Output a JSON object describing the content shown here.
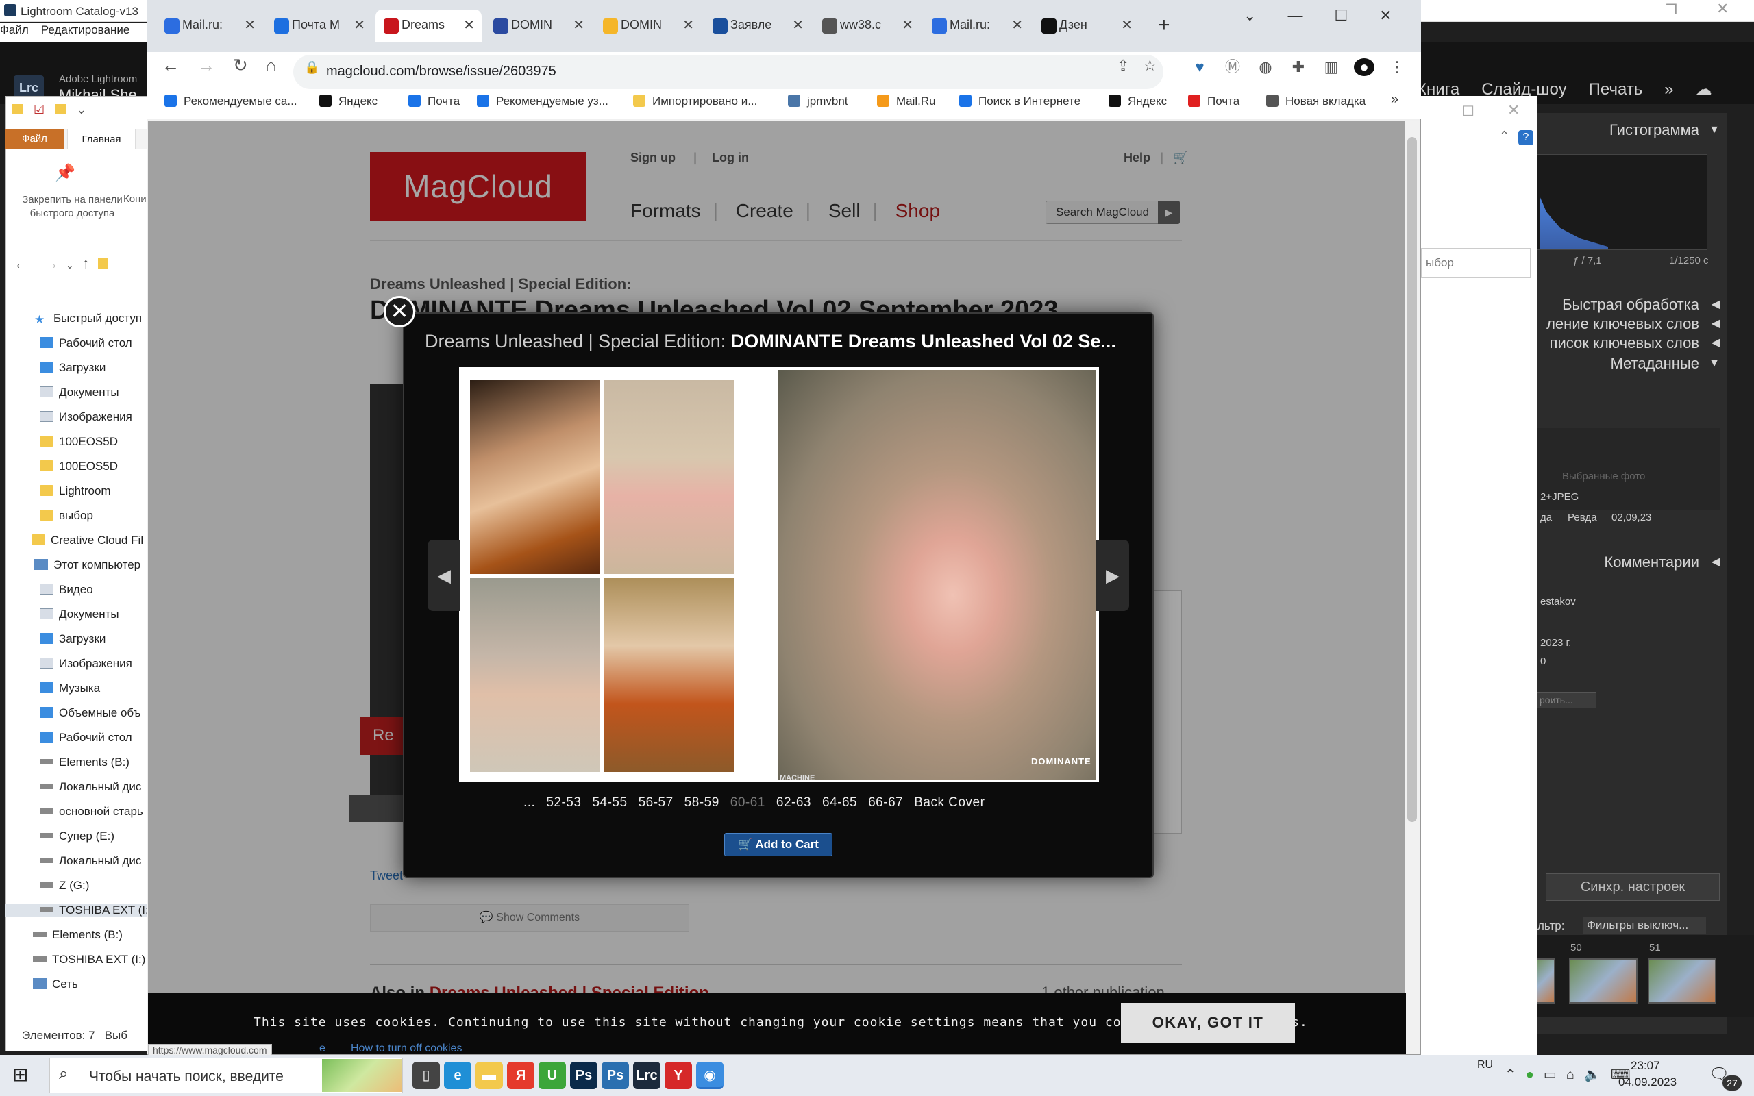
{
  "lightroom": {
    "window_title": "Lightroom Catalog-v13",
    "menu": [
      "Файл",
      "Редактирование"
    ],
    "brand": "Adobe Lightroom",
    "user": "Mikhail She",
    "modules": [
      "Книга",
      "Слайд-шоу",
      "Печать"
    ],
    "panels": [
      "Гистограмма",
      "Быстрая обработка",
      "ление ключевых слов",
      "писок ключевых слов",
      "Метаданные",
      "Комментарии"
    ],
    "histo_aperture": "ƒ / 7,1",
    "histo_shutter": "1/1250 с",
    "meta_saved": "Выбранные фото",
    "meta_format": "2+JPEG",
    "meta_row_1": "да",
    "meta_row_2": "Ревда",
    "meta_row_3": "02,09,23",
    "meta_author": "estakov",
    "meta_date": "2023 г.",
    "meta_d2": "0",
    "meta_btn": "роить...",
    "sync_btn": "Синхр. настроек",
    "filter_label": "льтр:",
    "filter_value": "Фильтры выключ...",
    "film_nums": [
      "50",
      "51"
    ]
  },
  "lr_dialog": {
    "search": "ыбор",
    "help": "?"
  },
  "explorer": {
    "tab_file": "Файл",
    "tab_home": "Главная",
    "pin_label": "Закрепить на панели быстрого доступа",
    "copy_label": "Копи",
    "tree": [
      {
        "label": "Быстрый доступ",
        "icon": "star"
      },
      {
        "label": "Рабочий стол",
        "icon": "blue"
      },
      {
        "label": "Загрузки",
        "icon": "blue"
      },
      {
        "label": "Документы",
        "icon": "doc"
      },
      {
        "label": "Изображения",
        "icon": "doc"
      },
      {
        "label": "100EOS5D",
        "icon": "folder"
      },
      {
        "label": "100EOS5D",
        "icon": "folder"
      },
      {
        "label": "Lightroom",
        "icon": "folder"
      },
      {
        "label": "выбор",
        "icon": "folder"
      },
      {
        "label": "Creative Cloud Fil",
        "icon": "folder"
      },
      {
        "label": "Этот компьютер",
        "icon": "pc"
      },
      {
        "label": "Видео",
        "icon": "doc"
      },
      {
        "label": "Документы",
        "icon": "doc"
      },
      {
        "label": "Загрузки",
        "icon": "blue"
      },
      {
        "label": "Изображения",
        "icon": "doc"
      },
      {
        "label": "Музыка",
        "icon": "blue"
      },
      {
        "label": "Объемные объ",
        "icon": "blue"
      },
      {
        "label": "Рабочий стол",
        "icon": "blue"
      },
      {
        "label": "Elements (B:)",
        "icon": "drive"
      },
      {
        "label": "Локальный дис",
        "icon": "drive"
      },
      {
        "label": "основной старь",
        "icon": "drive"
      },
      {
        "label": "Супер (E:)",
        "icon": "drive"
      },
      {
        "label": "Локальный дис",
        "icon": "drive"
      },
      {
        "label": "Z (G:)",
        "icon": "drive"
      },
      {
        "label": "TOSHIBA EXT (I:)",
        "icon": "drive"
      },
      {
        "label": "Elements (B:)",
        "icon": "drive"
      },
      {
        "label": "TOSHIBA EXT (I:)",
        "icon": "drive"
      },
      {
        "label": "Сеть",
        "icon": "pc"
      }
    ],
    "status": "Элементов: 7",
    "status2": "Выб"
  },
  "browser": {
    "tabs": [
      {
        "label": "Mail.ru:",
        "color": "#2c6de0"
      },
      {
        "label": "Почта М",
        "color": "#1d6fe0"
      },
      {
        "label": "Dreams",
        "color": "#c8161d"
      },
      {
        "label": "DOMIN",
        "color": "#2b4aa0"
      },
      {
        "label": "DOMIN",
        "color": "#f5b629"
      },
      {
        "label": "Заявле",
        "color": "#1a4f9c"
      },
      {
        "label": "ww38.c",
        "color": "#555555"
      },
      {
        "label": "Mail.ru:",
        "color": "#2c6de0"
      },
      {
        "label": "Дзен",
        "color": "#111111"
      }
    ],
    "url": "magcloud.com/browse/issue/2603975",
    "bookmarks": [
      {
        "label": "Рекомендуемые са...",
        "color": "#1a73e8"
      },
      {
        "label": "Яндекс",
        "color": "#111111"
      },
      {
        "label": "Почта",
        "color": "#1a73e8"
      },
      {
        "label": "Рекомендуемые уз...",
        "color": "#1a73e8"
      },
      {
        "label": "Импортировано и...",
        "color": "#f3c94c"
      },
      {
        "label": "jpmvbnt",
        "color": "#4a76a8"
      },
      {
        "label": "Mail.Ru",
        "color": "#f59a1a"
      },
      {
        "label": "Поиск в Интернете",
        "color": "#1a73e8"
      },
      {
        "label": "Яндекс",
        "color": "#111111"
      },
      {
        "label": "Почта",
        "color": "#e02020"
      },
      {
        "label": "Новая вкладка",
        "color": "#555555"
      }
    ],
    "status_url": "https://www.magcloud.com"
  },
  "magcloud": {
    "logo": "MagCloud",
    "sign_up": "Sign up",
    "log_in": "Log in",
    "help": "Help",
    "nav": [
      "Formats",
      "Create",
      "Sell",
      "Shop"
    ],
    "search_placeholder": "Search MagCloud",
    "series": "Dreams Unleashed | Special Edition:",
    "title": "DOMINANTE Dreams Unleashed Vol 02 September 2023",
    "cover_badge": "Re",
    "tweet": "Tweet",
    "show_comments": "Show Comments",
    "also_in": "Also in",
    "also_in_series": "Dreams Unleashed | Special Edition",
    "other": "1 other publication"
  },
  "modal": {
    "series": "Dreams Unleashed | Special Edition:",
    "title": "DOMINANTE Dreams Unleashed Vol 02 Se...",
    "page_brand": "DOMINANTE",
    "page_footer": "MACHINE",
    "pages": [
      "...",
      "52-53",
      "54-55",
      "56-57",
      "58-59",
      "60-61",
      "62-63",
      "64-65",
      "66-67",
      "Back Cover"
    ],
    "current_page": "60-61",
    "add_to_cart": "Add to Cart"
  },
  "cookie": {
    "text": "This site uses cookies. Continuing to use this site without changing your cookie settings means that you consent to those cookies.",
    "button": "OKAY, GOT IT",
    "link_partial": "е",
    "link": "How to turn off cookies"
  },
  "taskbar": {
    "search_placeholder": "Чтобы начать поиск, введите",
    "apps": [
      {
        "name": "task-view",
        "label": "▯",
        "color": "#444444"
      },
      {
        "name": "edge",
        "label": "e",
        "color": "#1f8fd6"
      },
      {
        "name": "explorer",
        "label": "▬",
        "color": "#f3c94c"
      },
      {
        "name": "yandex",
        "label": "Я",
        "color": "#e53a2c"
      },
      {
        "name": "utorrent",
        "label": "U",
        "color": "#3ca63a"
      },
      {
        "name": "photoshop",
        "label": "Ps",
        "color": "#0a2a4a"
      },
      {
        "name": "photoshop-2",
        "label": "Ps",
        "color": "#2a6fb0"
      },
      {
        "name": "lightroom",
        "label": "Lrc",
        "color": "#1c2a3c"
      },
      {
        "name": "yandex-browser",
        "label": "Y",
        "color": "#d62828"
      },
      {
        "name": "chrome",
        "label": "◉",
        "color": "#3b8de0"
      }
    ],
    "lang": "RU",
    "time": "23:07",
    "date": "04.09.2023",
    "notifications": "27"
  }
}
